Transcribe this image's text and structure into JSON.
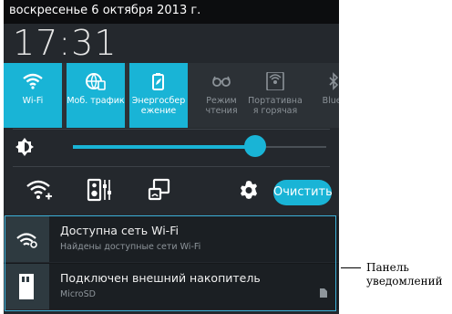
{
  "status": {
    "date": "воскресенье 6 октября 2013 г.",
    "time": "17:31"
  },
  "quick_settings": [
    {
      "label": "Wi-Fi",
      "active": true,
      "icon": "wifi-icon"
    },
    {
      "label": "Моб. трафик",
      "active": true,
      "icon": "mobile-data-icon"
    },
    {
      "label": "Энергосбер ежение",
      "active": true,
      "icon": "power-saving-icon"
    },
    {
      "label": "Режим чтения",
      "active": false,
      "icon": "reading-mode-icon"
    },
    {
      "label": "Портативна я горячая",
      "active": false,
      "icon": "hotspot-icon"
    },
    {
      "label": "Bluet",
      "active": false,
      "icon": "bluetooth-icon"
    }
  ],
  "brightness": {
    "level_percent": 72
  },
  "actions": {
    "clear_label": "Очистить"
  },
  "notifications": [
    {
      "title": "Доступна сеть Wi-Fi",
      "subtitle": "Найдены доступные сети Wi-Fi",
      "icon": "wifi-available-icon"
    },
    {
      "title": "Подключен внешний накопитель",
      "subtitle": "MicroSD",
      "icon": "sd-card-icon"
    }
  ],
  "callout": {
    "line1": "Панель",
    "line2": "уведомлений"
  },
  "colors": {
    "accent": "#19b4d6",
    "panel": "#24282d",
    "frame": "#3cb0d8"
  }
}
